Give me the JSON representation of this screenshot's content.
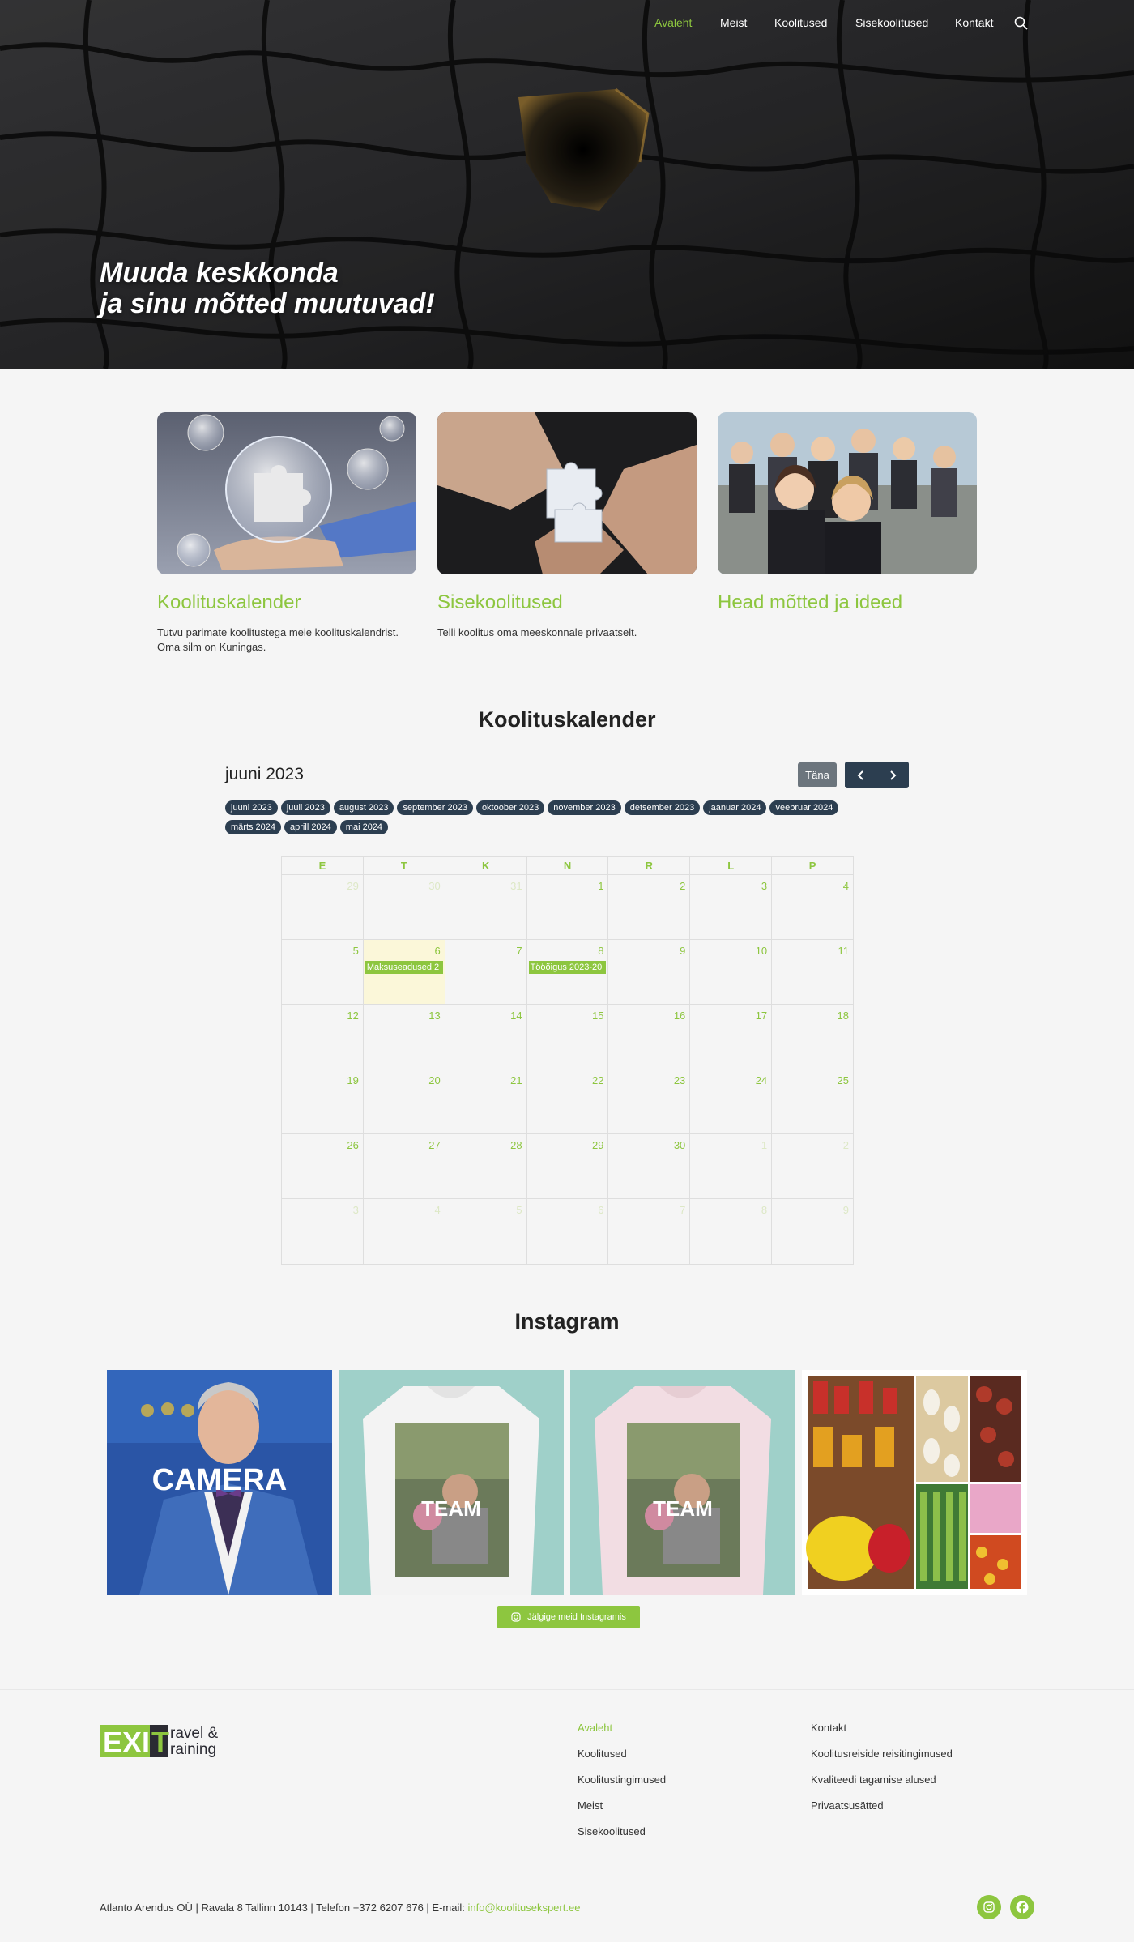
{
  "nav": {
    "items": [
      {
        "label": "Avaleht",
        "active": true
      },
      {
        "label": "Meist",
        "active": false
      },
      {
        "label": "Koolitused",
        "active": false
      },
      {
        "label": "Sisekoolitused",
        "active": false
      },
      {
        "label": "Kontakt",
        "active": false
      }
    ],
    "search_icon": "search-icon"
  },
  "hero": {
    "line1": "Muuda keskkonda",
    "line2": "ja sinu mõtted muutuvad!"
  },
  "cards": [
    {
      "title": "Koolituskalender",
      "text": "Tutvu parimate koolitustega meie koolituskalendrist. Oma silm on Kuningas."
    },
    {
      "title": "Sisekoolitused",
      "text": "Telli koolitus oma meeskonnale privaatselt."
    },
    {
      "title": "Head mõtted ja ideed",
      "text": ""
    }
  ],
  "calendar": {
    "section_title": "Koolituskalender",
    "month_title": "juuni 2023",
    "today_label": "Täna",
    "prev_icon": "chevron-left-icon",
    "next_icon": "chevron-right-icon",
    "months": [
      "juuni 2023",
      "juuli 2023",
      "august 2023",
      "september 2023",
      "oktoober 2023",
      "november 2023",
      "detsember 2023",
      "jaanuar 2024",
      "veebruar 2024",
      "märts 2024",
      "aprill 2024",
      "mai 2024"
    ],
    "weekdays": [
      "E",
      "T",
      "K",
      "N",
      "R",
      "L",
      "P"
    ],
    "weeks": [
      [
        {
          "d": "29",
          "o": true
        },
        {
          "d": "30",
          "o": true
        },
        {
          "d": "31",
          "o": true
        },
        {
          "d": "1"
        },
        {
          "d": "2"
        },
        {
          "d": "3"
        },
        {
          "d": "4"
        }
      ],
      [
        {
          "d": "5"
        },
        {
          "d": "6",
          "today": true,
          "event": "Maksuseadused 2"
        },
        {
          "d": "7"
        },
        {
          "d": "8",
          "event": "Tööõigus 2023-20"
        },
        {
          "d": "9"
        },
        {
          "d": "10"
        },
        {
          "d": "11"
        }
      ],
      [
        {
          "d": "12"
        },
        {
          "d": "13"
        },
        {
          "d": "14"
        },
        {
          "d": "15"
        },
        {
          "d": "16"
        },
        {
          "d": "17"
        },
        {
          "d": "18"
        }
      ],
      [
        {
          "d": "19"
        },
        {
          "d": "20"
        },
        {
          "d": "21"
        },
        {
          "d": "22"
        },
        {
          "d": "23"
        },
        {
          "d": "24"
        },
        {
          "d": "25"
        }
      ],
      [
        {
          "d": "26"
        },
        {
          "d": "27"
        },
        {
          "d": "28"
        },
        {
          "d": "29"
        },
        {
          "d": "30"
        },
        {
          "d": "1",
          "o": true
        },
        {
          "d": "2",
          "o": true
        }
      ],
      [
        {
          "d": "3",
          "o": true
        },
        {
          "d": "4",
          "o": true
        },
        {
          "d": "5",
          "o": true
        },
        {
          "d": "6",
          "o": true
        },
        {
          "d": "7",
          "o": true
        },
        {
          "d": "8",
          "o": true
        },
        {
          "d": "9",
          "o": true
        }
      ]
    ]
  },
  "instagram": {
    "section_title": "Instagram",
    "posts": [
      {
        "caption": "CAMERA"
      },
      {
        "caption": "TEAM"
      },
      {
        "caption": "TEAM"
      },
      {
        "caption": ""
      }
    ],
    "follow_label": "Jälgige meid Instagramis",
    "follow_icon": "instagram-icon"
  },
  "footer": {
    "logo_text": "EXIT ravel & raining",
    "col1": [
      {
        "label": "Avaleht",
        "active": true
      },
      {
        "label": "Koolitused"
      },
      {
        "label": "Koolitustingimused"
      },
      {
        "label": "Meist"
      },
      {
        "label": "Sisekoolitused"
      }
    ],
    "col2": [
      {
        "label": "Kontakt"
      },
      {
        "label": "Koolitusreiside reisitingimused"
      },
      {
        "label": "Kvaliteedi tagamise alused"
      },
      {
        "label": "Privaatsusätted"
      }
    ],
    "address": "Atlanto Arendus OÜ | Ravala 8 Tallinn 10143 | Telefon +372 6207 676 | E-mail: ",
    "email": "info@koolitusekspert.ee",
    "social": [
      "instagram-icon",
      "facebook-icon"
    ]
  },
  "colors": {
    "accent": "#8dc63f",
    "dark_button": "#2c3e50",
    "today_bg": "#fbf7d9"
  }
}
